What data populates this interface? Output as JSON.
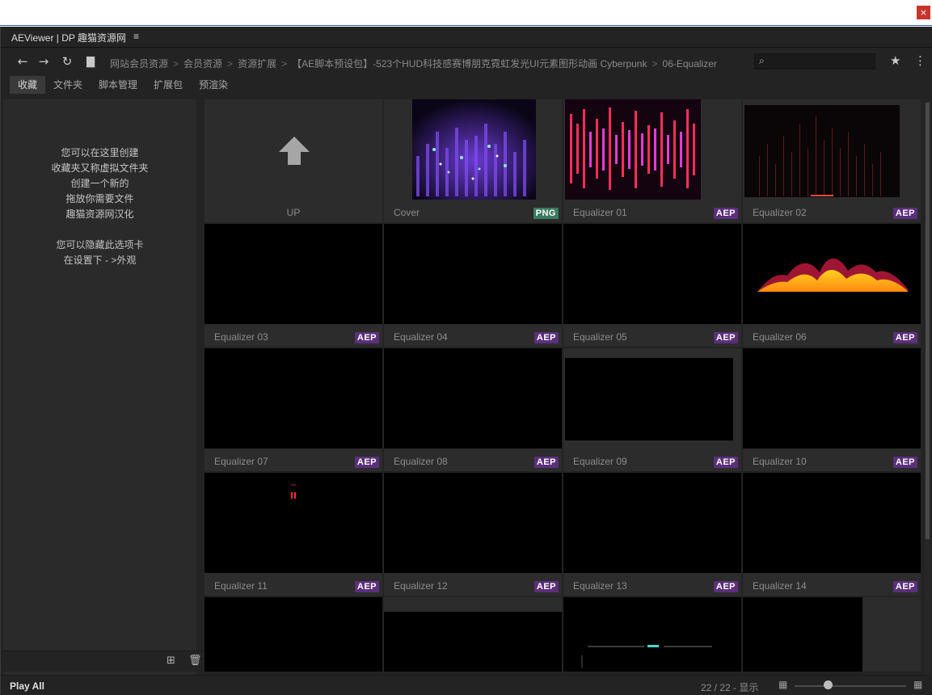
{
  "window": {
    "close_glyph": "×"
  },
  "panel": {
    "title": "AEViewer | DP 趣猫资源网",
    "menu_glyph": "≡"
  },
  "nav": {
    "back_icon": "←",
    "forward_icon": "→",
    "refresh_icon": "↻",
    "folder_icon": "▇",
    "breadcrumbs": [
      "网站会员资源",
      "会员资源",
      "资源扩展",
      "【AE脚本预设包】-523个HUD科技感赛博朋克霓虹发光UI元素图形动画 Cyberpunk",
      "06-Equalizer"
    ],
    "separator": ">",
    "search_placeholder": "",
    "search_icon": "⌕",
    "star_icon": "★",
    "more_icon": "⋮"
  },
  "tabs": [
    "收藏",
    "文件夹",
    "脚本管理",
    "扩展包",
    "预渲染"
  ],
  "sidebar": {
    "lines": [
      "您可以在这里创建",
      "收藏夹又称虚拟文件夹",
      "创建一个新的",
      "拖放你需要文件",
      "趣猫资源网汉化",
      "",
      "您可以隐藏此选项卡",
      "在设置下 - >外观"
    ],
    "add_icon": "⊞",
    "trash_icon": "🗑"
  },
  "tiles": [
    {
      "label": "UP",
      "badge": ""
    },
    {
      "label": "Cover",
      "badge": "PNG"
    },
    {
      "label": "Equalizer 01",
      "badge": "AEP"
    },
    {
      "label": "Equalizer 02",
      "badge": "AEP"
    },
    {
      "label": "Equalizer 03",
      "badge": "AEP"
    },
    {
      "label": "Equalizer 04",
      "badge": "AEP"
    },
    {
      "label": "Equalizer 05",
      "badge": "AEP"
    },
    {
      "label": "Equalizer 06",
      "badge": "AEP"
    },
    {
      "label": "Equalizer 07",
      "badge": "AEP"
    },
    {
      "label": "Equalizer 08",
      "badge": "AEP"
    },
    {
      "label": "Equalizer 09",
      "badge": "AEP"
    },
    {
      "label": "Equalizer 10",
      "badge": "AEP"
    },
    {
      "label": "Equalizer 11",
      "badge": "AEP"
    },
    {
      "label": "Equalizer 12",
      "badge": "AEP"
    },
    {
      "label": "Equalizer 13",
      "badge": "AEP"
    },
    {
      "label": "Equalizer 14",
      "badge": "AEP"
    }
  ],
  "status": {
    "play_all": "Play All",
    "count": "22 / 22 - 显示",
    "grid_small_icon": "▦",
    "grid_large_icon": "▦"
  }
}
